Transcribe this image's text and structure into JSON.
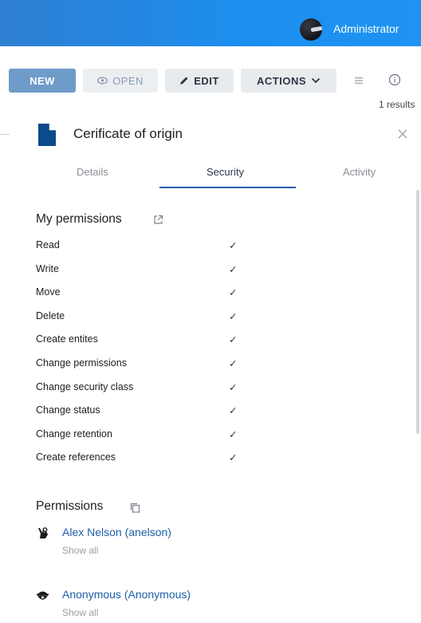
{
  "header": {
    "user_name": "Administrator",
    "avatar_icon": "user-avatar",
    "bar_color": "#1b8ff0"
  },
  "toolbar": {
    "new_label": "NEW",
    "open_label": "OPEN",
    "edit_label": "EDIT",
    "actions_label": "ACTIONS",
    "results_text": "1 results",
    "icons": [
      "eye-icon",
      "pencil-icon",
      "chevron-down-icon",
      "list-icon",
      "info-icon"
    ]
  },
  "panel": {
    "title": "Cerificate of origin",
    "tabs": [
      {
        "label": "Details",
        "active": false
      },
      {
        "label": "Security",
        "active": true
      },
      {
        "label": "Activity",
        "active": false
      }
    ],
    "accent_color": "#1e5fa8"
  },
  "my_permissions": {
    "title": "My permissions",
    "check": "✓",
    "items": [
      {
        "label": "Read"
      },
      {
        "label": "Write"
      },
      {
        "label": "Move"
      },
      {
        "label": "Delete"
      },
      {
        "label": "Create entites"
      },
      {
        "label": "Change permissions"
      },
      {
        "label": "Change security class"
      },
      {
        "label": "Change status"
      },
      {
        "label": "Change retention"
      },
      {
        "label": "Create references"
      }
    ]
  },
  "permissions": {
    "title": "Permissions",
    "show_all_label": "Show all",
    "users": [
      {
        "name": "Alex Nelson (anelson)",
        "icon": "ok-hand-icon"
      },
      {
        "name": "Anonymous (Anonymous)",
        "icon": "anonymous-mask-icon"
      }
    ]
  }
}
